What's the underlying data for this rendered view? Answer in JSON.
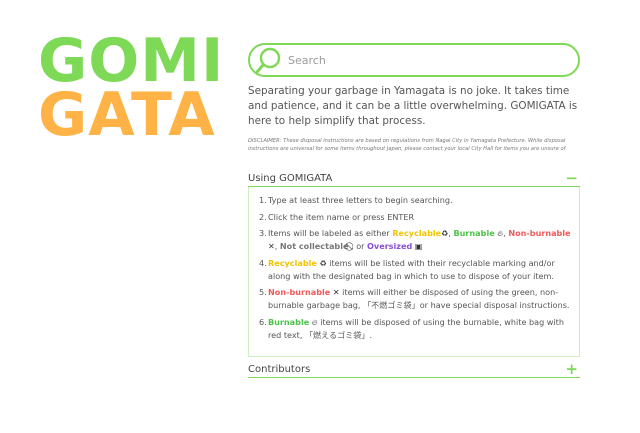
{
  "logo": {
    "line1": "GOMI",
    "line2": "GATA"
  },
  "search": {
    "placeholder": "Search",
    "value": ""
  },
  "intro": "Separating your garbage in Yamagata is no joke. It takes time and patience, and it can be a little overwhelming. GOMIGATA is here to help simplify that process.",
  "disclaimer": "DISCLAIMER: These disposal instructions are based on regulations from Nagai City in Yamagata Prefecture. While disposal instructions are universal for some items throughout Japan, please contact your local City Hall for items you are unsure of.",
  "using_section": {
    "title": "Using GOMIGATA",
    "toggle": "−",
    "steps": {
      "s1": {
        "num": "1.",
        "text": "Type at least three letters to begin searching."
      },
      "s2": {
        "num": "2.",
        "text": "Click the item name or press ENTER"
      },
      "s3": {
        "num": "3.",
        "pre": "Items will be labeled as either ",
        "recyclable": "Recyclable",
        "sep1": ", ",
        "burnable": "Burnable",
        "sep2": ", ",
        "nonburnable": "Non-burnable",
        "sep3": ", ",
        "notcollectable": "Not collectable",
        "sep4": ", or ",
        "oversized": "Oversized"
      },
      "s4": {
        "num": "4.",
        "tag": "Recyclable",
        "text": " items will be listed with their recyclable marking and/or along with the designated bag in which to use to dispose of your item."
      },
      "s5": {
        "num": "5.",
        "tag": "Non-burnable",
        "text": " items will either be disposed of using the green, non-burnable garbage bag, 「不燃ゴミ袋」or have special disposal instructions."
      },
      "s6": {
        "num": "6.",
        "tag": "Burnable",
        "text": " items will be disposed of using the burnable, white bag with red text, 「燃えるゴミ袋」."
      }
    }
  },
  "contributors_section": {
    "title": "Contributors",
    "toggle": "+"
  },
  "icons": {
    "search": "search-icon",
    "recycle": "recycle-icon",
    "flame": "flame-icon",
    "cross": "cross-icon",
    "prohibited": "prohibited-icon",
    "oversized": "box-icon"
  },
  "colors": {
    "green": "#7ed957",
    "orange": "#ffb347",
    "recyclable": "#f2c400",
    "burnable": "#4cc34a",
    "nonburnable": "#ef5a5a",
    "oversized": "#8a4fd6"
  }
}
